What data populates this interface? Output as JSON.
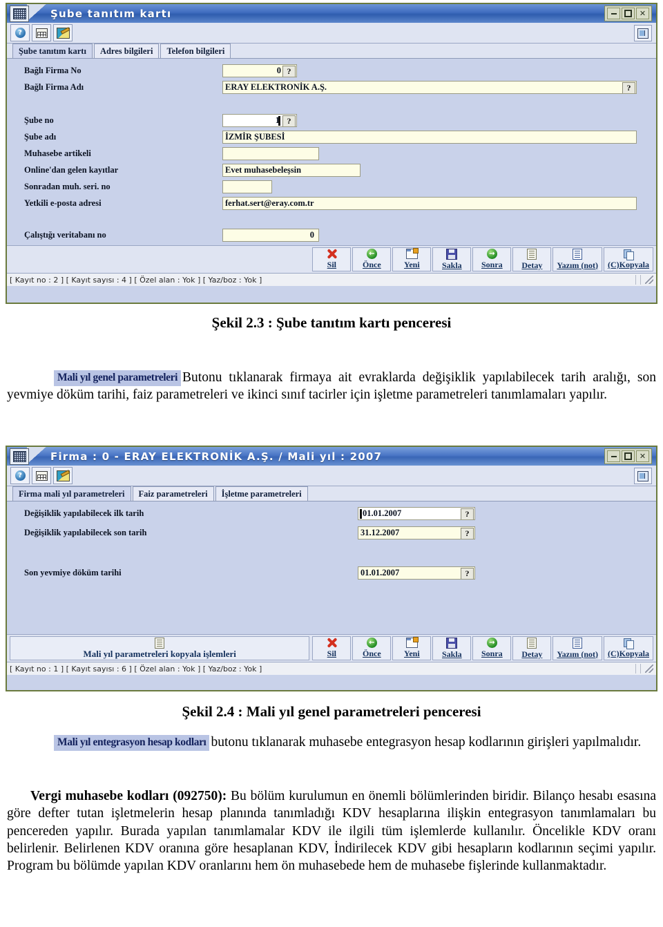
{
  "document": {
    "figure_1_caption": "Şekil 2.3 :  Şube tanıtım kartı penceresi",
    "figure_2_caption": "Şekil 2.4 :  Mali yıl genel parametreleri penceresi",
    "paragraph_1": {
      "button_label": "Mali yıl genel parametreleri",
      "text": "Butonu tıklanarak firmaya ait evraklarda değişiklik yapılabilecek tarih aralığı, son yevmiye döküm tarihi, faiz parametreleri ve ikinci sınıf tacirler için işletme parametreleri tanımlamaları yapılır."
    },
    "paragraph_2": {
      "button_label": "Mali yıl entegrasyon hesap kodları",
      "text": "butonu tıklanarak muhasebe entegrasyon hesap kodlarının girişleri yapılmalıdır."
    },
    "paragraph_3": {
      "heading": "Vergi muhasebe kodları (092750):",
      "text": "Bu bölüm kurulumun en önemli bölümlerinden biridir. Bilanço hesabı esasına göre defter tutan işletmelerin hesap planında tanımladığı KDV hesaplarına ilişkin entegrasyon tanımlamaları bu pencereden yapılır. Burada yapılan tanımlamalar KDV ile ilgili tüm işlemlerde kullanılır. Öncelikle KDV oranı belirlenir. Belirlenen KDV oranına göre hesaplanan KDV, İndirilecek KDV gibi hesapların kodlarının seçimi yapılır. Program bu bölümde yapılan KDV oranlarını hem ön muhasebede hem de muhasebe fişlerinde kullanmaktadır."
    }
  },
  "window1": {
    "title": "Şube tanıtım kartı",
    "window_buttons": {
      "minimize": "–",
      "maximize": "□",
      "close": "✕"
    },
    "toolbar_icons": [
      "help-icon",
      "calculator-icon",
      "edit-icon",
      "book-icon"
    ],
    "tabs": [
      {
        "label": "Şube tanıtım kartı",
        "active": true
      },
      {
        "label": "Adres bilgileri",
        "active": false
      },
      {
        "label": "Telefon bilgileri",
        "active": false
      }
    ],
    "fields": [
      {
        "label": "Bağlı Firma No",
        "value": "0",
        "help": "?"
      },
      {
        "label": "Bağlı Firma Adı",
        "value": "ERAY ELEKTRONİK A.Ş.",
        "help": "?"
      },
      {
        "label": "Şube no",
        "value": "1",
        "help": "?"
      },
      {
        "label": "Şube adı",
        "value": "İZMİR ŞUBESİ"
      },
      {
        "label": "Muhasebe artikeli",
        "value": ""
      },
      {
        "label": "Online'dan gelen kayıtlar",
        "value": "Evet muhasebeleşsin"
      },
      {
        "label": "Sonradan muh. seri. no",
        "value": ""
      },
      {
        "label": "Yetkili e-posta adresi",
        "value": "ferhat.sert@eray.com.tr"
      },
      {
        "label": "Çalıştığı veritabanı no",
        "value": "0"
      }
    ],
    "actions": [
      {
        "label": "Sil",
        "icon": "delete-icon"
      },
      {
        "label": "Önce",
        "icon": "previous-icon"
      },
      {
        "label": "Yeni",
        "icon": "new-icon"
      },
      {
        "label": "Sakla",
        "icon": "save-icon"
      },
      {
        "label": "Sonra",
        "icon": "next-icon"
      },
      {
        "label": "Detay",
        "icon": "detail-icon"
      },
      {
        "label": "Yazım (not)",
        "icon": "note-icon"
      },
      {
        "label": "(C)Kopyala",
        "icon": "copy-icon"
      }
    ],
    "status": "[ Kayıt no : 2 ] [ Kayıt sayısı : 4 ] [ Özel alan : Yok ] [ Yaz/boz : Yok ]"
  },
  "window2": {
    "title": "Firma : 0 - ERAY ELEKTRONİK A.Ş.  / Mali yıl : 2007",
    "window_buttons": {
      "minimize": "–",
      "maximize": "□",
      "close": "✕"
    },
    "toolbar_icons": [
      "help-icon",
      "calculator-icon",
      "edit-icon",
      "book-icon"
    ],
    "tabs": [
      {
        "label": "Firma mali yıl parametreleri",
        "active": true
      },
      {
        "label": "Faiz parametreleri",
        "active": false
      },
      {
        "label": "İşletme parametreleri",
        "active": false
      }
    ],
    "fields": [
      {
        "label": "Değişiklik yapılabilecek ilk tarih",
        "value": "01.01.2007",
        "help": "?"
      },
      {
        "label": "Değişiklik yapılabilecek son tarih",
        "value": "31.12.2007",
        "help": "?"
      },
      {
        "label": "Son yevmiye döküm tarihi",
        "value": "01.01.2007",
        "help": "?"
      }
    ],
    "copy_button": {
      "label": "Mali yıl parametreleri kopyala işlemleri",
      "icon": "detail-icon"
    },
    "actions": [
      {
        "label": "Sil",
        "icon": "delete-icon"
      },
      {
        "label": "Önce",
        "icon": "previous-icon"
      },
      {
        "label": "Yeni",
        "icon": "new-icon"
      },
      {
        "label": "Sakla",
        "icon": "save-icon"
      },
      {
        "label": "Sonra",
        "icon": "next-icon"
      },
      {
        "label": "Detay",
        "icon": "detail-icon"
      },
      {
        "label": "Yazım (not)",
        "icon": "note-icon"
      },
      {
        "label": "(C)Kopyala",
        "icon": "copy-icon"
      }
    ],
    "status": "[ Kayıt no : 1 ] [ Kayıt sayısı : 6 ] [ Özel alan : Yok ] [ Yaz/boz : Yok ]"
  },
  "colors": {
    "window_border": "#6a7a3d",
    "form_background": "#c9d2ea",
    "field_background": "#fdfde6",
    "titlebar_blue": "#3f6cbf",
    "highlight_blue": "#b9c4e4",
    "accent_text": "#13215c"
  }
}
